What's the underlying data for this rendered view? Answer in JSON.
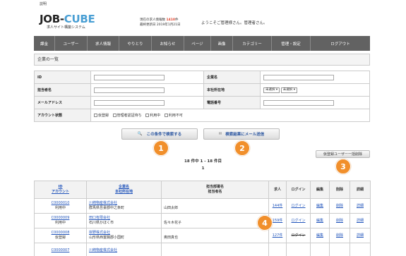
{
  "tab_label": "説明",
  "logo": {
    "main": "JOB-",
    "accent": "CUBE",
    "sub": "求人サイト構築システム"
  },
  "stats": {
    "line1_pre": "現在の求人情報数",
    "count": "1410",
    "line1_post": "件",
    "line2": "最終更新日 2019年1月21日"
  },
  "welcome": "ようこそご管理様さん。管理者さん。",
  "nav": [
    "課金",
    "ユーザー",
    "求人情報",
    "やりとり",
    "お知らせ",
    "ページ",
    "画像",
    "カテゴリー",
    "管理・設定",
    "ログアウト"
  ],
  "section_title": "企業の一覧",
  "form": {
    "id_label": "ID",
    "company_label": "企業名",
    "person_label": "担当者名",
    "location_label": "本社所在地",
    "location_sel1": "未選択",
    "location_sel2": "未選択",
    "email_label": "メールアドレス",
    "phone_label": "電話番号",
    "status_label": "アカウント状態",
    "statuses": [
      "仮登録",
      "管理者認証待ち",
      "利用中",
      "利用不可"
    ]
  },
  "buttons": {
    "search": "この条件で検索する",
    "mail": "検索結果にメール送信",
    "bulk_delete": "仮登録ユーザー一括削除"
  },
  "badges": [
    "1",
    "2",
    "3",
    "4"
  ],
  "result_info": "18 件中 1 - 18 件目",
  "page": "1",
  "table": {
    "headers": {
      "id_a": "ID",
      "id_b": "アカウント",
      "co_a": "企業名",
      "co_b": "本社所在地",
      "dept_a": "担当部署名",
      "dept_b": "担当者名",
      "jobs": "求人",
      "login": "ログイン",
      "edit": "編集",
      "del": "削除",
      "detail": "詳細"
    },
    "rows": [
      {
        "id": "C0000010",
        "status": "利用中",
        "company": "川崎物産株式会社",
        "address": "群馬県吾妻郡中之条町",
        "person": "山田太郎",
        "jobs": "144件",
        "login": "ログイン",
        "edit": "編集",
        "del": "削除",
        "detail": "詳細"
      },
      {
        "id": "C0000009",
        "status": "利用中",
        "company": "田口有限会社",
        "address": "石川県かほく市",
        "person": "佐々木花子",
        "jobs": "159件",
        "login": "ログイン",
        "edit": "編集",
        "del": "削除",
        "detail": "詳細"
      },
      {
        "id": "C0000008",
        "status": "仮登録",
        "company": "岸野株式会社",
        "address": "山形県西置賜郡小国町",
        "person": "奥田真也",
        "jobs": "127件",
        "login": "ログイン",
        "edit": "編集",
        "del": "削除",
        "detail": "詳細"
      },
      {
        "id": "C0000007",
        "status": "",
        "company": "川崎物産株式会社",
        "address": "",
        "person": "",
        "jobs": "",
        "login": "",
        "edit": "",
        "del": "",
        "detail": ""
      }
    ]
  },
  "colors": {
    "nav": "#626262",
    "accent": "#4a9fd4",
    "badge": "#f18f2b",
    "link": "#2255bb"
  }
}
